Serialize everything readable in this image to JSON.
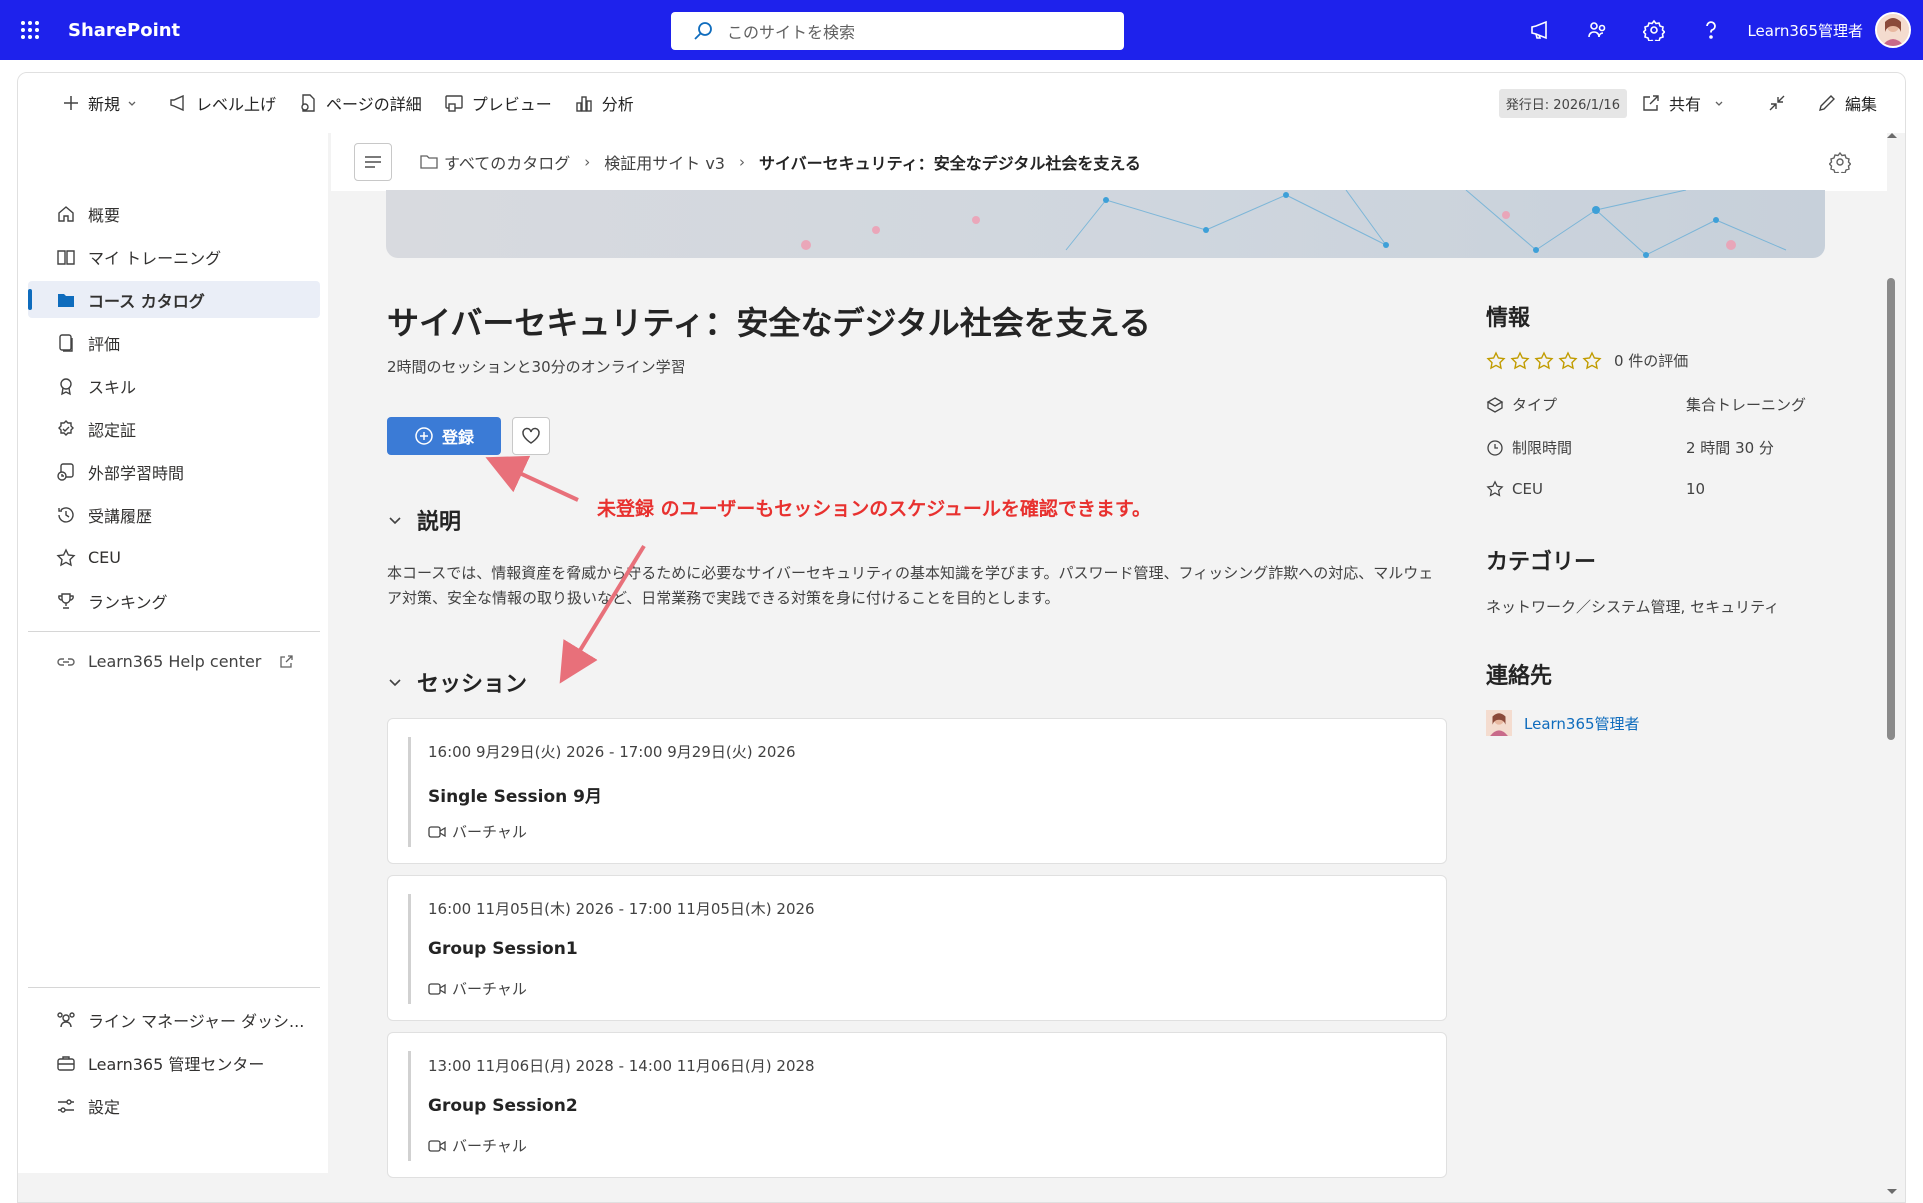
{
  "suitebar": {
    "app_name": "SharePoint",
    "search_placeholder": "このサイトを検索",
    "user_name": "Learn365管理者"
  },
  "command_bar": {
    "new": "新規",
    "level_up": "レベル上げ",
    "page_details": "ページの詳細",
    "preview": "プレビュー",
    "analytics": "分析",
    "published": "発行日: 2026/1/16",
    "share": "共有",
    "edit": "編集"
  },
  "nav": {
    "items": [
      {
        "label": "概要",
        "icon": "home-icon"
      },
      {
        "label": "マイ トレーニング",
        "icon": "book-icon"
      },
      {
        "label": "コース カタログ",
        "icon": "folder-icon",
        "active": true
      },
      {
        "label": "評価",
        "icon": "document-icon"
      },
      {
        "label": "スキル",
        "icon": "ribbon-icon"
      },
      {
        "label": "認定証",
        "icon": "certificate-icon"
      },
      {
        "label": "外部学習時間",
        "icon": "external-time-icon"
      },
      {
        "label": "受講履歴",
        "icon": "history-icon"
      },
      {
        "label": "CEU",
        "icon": "star-icon"
      },
      {
        "label": "ランキング",
        "icon": "trophy-icon"
      }
    ],
    "help_center": "Learn365 Help center",
    "bottom_items": [
      {
        "label": "ライン マネージャー ダッシ...",
        "icon": "people-icon"
      },
      {
        "label": "Learn365 管理センター",
        "icon": "briefcase-icon"
      },
      {
        "label": "設定",
        "icon": "sliders-icon"
      }
    ]
  },
  "breadcrumb": {
    "items": [
      "すべてのカタログ",
      "検証用サイト v3",
      "サイバーセキュリティ：安全なデジタル社会を支える"
    ]
  },
  "course": {
    "title": "サイバーセキュリティ：安全なデジタル社会を支える",
    "subtitle": "2時間のセッションと30分のオンライン学習",
    "enroll_label": "登録",
    "description_heading": "説明",
    "description": "本コースでは、情報資産を脅威から守るために必要なサイバーセキュリティの基本知識を学びます。パスワード管理、フィッシング詐欺への対応、マルウェア対策、安全な情報の取り扱いなど、日常業務で実践できる対策を身に付けることを目的とします。",
    "sessions_heading": "セッション",
    "sessions": [
      {
        "time": "16:00 9月29日(火) 2026 - 17:00 9月29日(火) 2026",
        "name": "Single Session 9月",
        "mode": "バーチャル"
      },
      {
        "time": "16:00 11月05日(木) 2026 - 17:00 11月05日(木) 2026",
        "name": "Group Session1",
        "mode": "バーチャル"
      },
      {
        "time": "13:00 11月06日(月) 2028 - 14:00 11月06日(月) 2028",
        "name": "Group Session2",
        "mode": "バーチャル"
      }
    ]
  },
  "info_panel": {
    "heading": "情報",
    "rating_stars": 0,
    "rating_text": "0 件の評価",
    "type_label": "タイプ",
    "type_value": "集合トレーニング",
    "duration_label": "制限時間",
    "duration_value": "2 時間 30 分",
    "ceu_label": "CEU",
    "ceu_value": "10",
    "category_heading": "カテゴリー",
    "category_value": "ネットワーク／システム管理, セキュリティ",
    "contact_heading": "連絡先",
    "contact_name": "Learn365管理者"
  },
  "annotation": {
    "text": "未登録 のユーザーもセッションのスケジュールを確認できます。",
    "color": "#e8312f"
  },
  "colors": {
    "suitebar": "#1e22ec",
    "accent": "#3b7bd6",
    "link": "#0f6cbd",
    "star": "#c19c00"
  }
}
